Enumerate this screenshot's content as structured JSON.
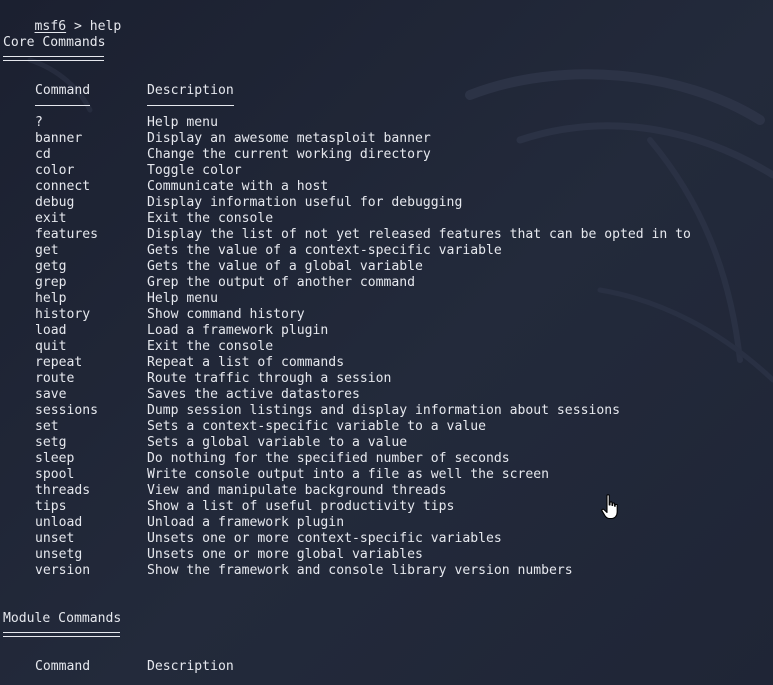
{
  "prompt": {
    "name": "msf6",
    "separator": " > ",
    "command": "help"
  },
  "core": {
    "title": "Core Commands",
    "column_command": "Command",
    "column_description": "Description",
    "rows": [
      {
        "command": "?",
        "description": "Help menu"
      },
      {
        "command": "banner",
        "description": "Display an awesome metasploit banner"
      },
      {
        "command": "cd",
        "description": "Change the current working directory"
      },
      {
        "command": "color",
        "description": "Toggle color"
      },
      {
        "command": "connect",
        "description": "Communicate with a host"
      },
      {
        "command": "debug",
        "description": "Display information useful for debugging"
      },
      {
        "command": "exit",
        "description": "Exit the console"
      },
      {
        "command": "features",
        "description": "Display the list of not yet released features that can be opted in to"
      },
      {
        "command": "get",
        "description": "Gets the value of a context-specific variable"
      },
      {
        "command": "getg",
        "description": "Gets the value of a global variable"
      },
      {
        "command": "grep",
        "description": "Grep the output of another command"
      },
      {
        "command": "help",
        "description": "Help menu"
      },
      {
        "command": "history",
        "description": "Show command history"
      },
      {
        "command": "load",
        "description": "Load a framework plugin"
      },
      {
        "command": "quit",
        "description": "Exit the console"
      },
      {
        "command": "repeat",
        "description": "Repeat a list of commands"
      },
      {
        "command": "route",
        "description": "Route traffic through a session"
      },
      {
        "command": "save",
        "description": "Saves the active datastores"
      },
      {
        "command": "sessions",
        "description": "Dump session listings and display information about sessions"
      },
      {
        "command": "set",
        "description": "Sets a context-specific variable to a value"
      },
      {
        "command": "setg",
        "description": "Sets a global variable to a value"
      },
      {
        "command": "sleep",
        "description": "Do nothing for the specified number of seconds"
      },
      {
        "command": "spool",
        "description": "Write console output into a file as well the screen"
      },
      {
        "command": "threads",
        "description": "View and manipulate background threads"
      },
      {
        "command": "tips",
        "description": "Show a list of useful productivity tips"
      },
      {
        "command": "unload",
        "description": "Unload a framework plugin"
      },
      {
        "command": "unset",
        "description": "Unsets one or more context-specific variables"
      },
      {
        "command": "unsetg",
        "description": "Unsets one or more global variables"
      },
      {
        "command": "version",
        "description": "Show the framework and console library version numbers"
      }
    ]
  },
  "module": {
    "title": "Module Commands",
    "column_command": "Command",
    "column_description": "Description"
  },
  "colors": {
    "background": "#1e2331",
    "text": "#e6e8ee"
  },
  "icons": {
    "cursor": "hand-pointer-icon",
    "background": "kali-dragon-watermark-icon"
  }
}
